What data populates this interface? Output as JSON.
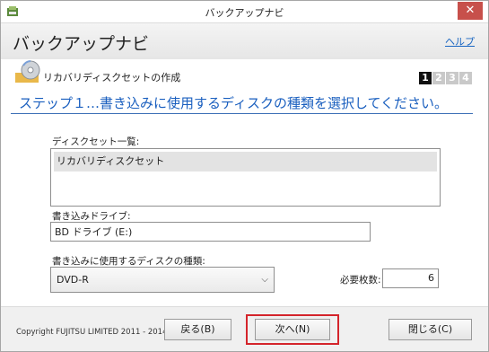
{
  "window": {
    "title": "バックアップナビ"
  },
  "header": {
    "app_title": "バックアップナビ",
    "help_label": "ヘルプ"
  },
  "section": {
    "title": "リカバリディスクセットの作成"
  },
  "steps": [
    "1",
    "2",
    "3",
    "4"
  ],
  "step_heading": "ステップ１…書き込みに使用するディスクの種類を選択してください。",
  "disk_set": {
    "label": "ディスクセット一覧:",
    "items": [
      "リカバリディスクセット"
    ]
  },
  "drive": {
    "label": "書き込みドライブ:",
    "value": "BD ドライブ (E:)"
  },
  "disk_type": {
    "label": "書き込みに使用するディスクの種類:",
    "selected": "DVD-R"
  },
  "required": {
    "label": "必要枚数:",
    "value": "6"
  },
  "footer": {
    "copyright": "Copyright FUJITSU LIMITED 2011 - 2014",
    "back_label": "戻る(B)",
    "next_label": "次へ(N)",
    "close_label": "閉じる(C)"
  },
  "icons": {
    "app": "app-icon",
    "disk": "disk-icon",
    "close": "close-icon",
    "dropdown": "chevron-down-icon"
  },
  "colors": {
    "heading": "#1a5fbf",
    "highlight": "#d4242b",
    "active_step": "#111111"
  }
}
